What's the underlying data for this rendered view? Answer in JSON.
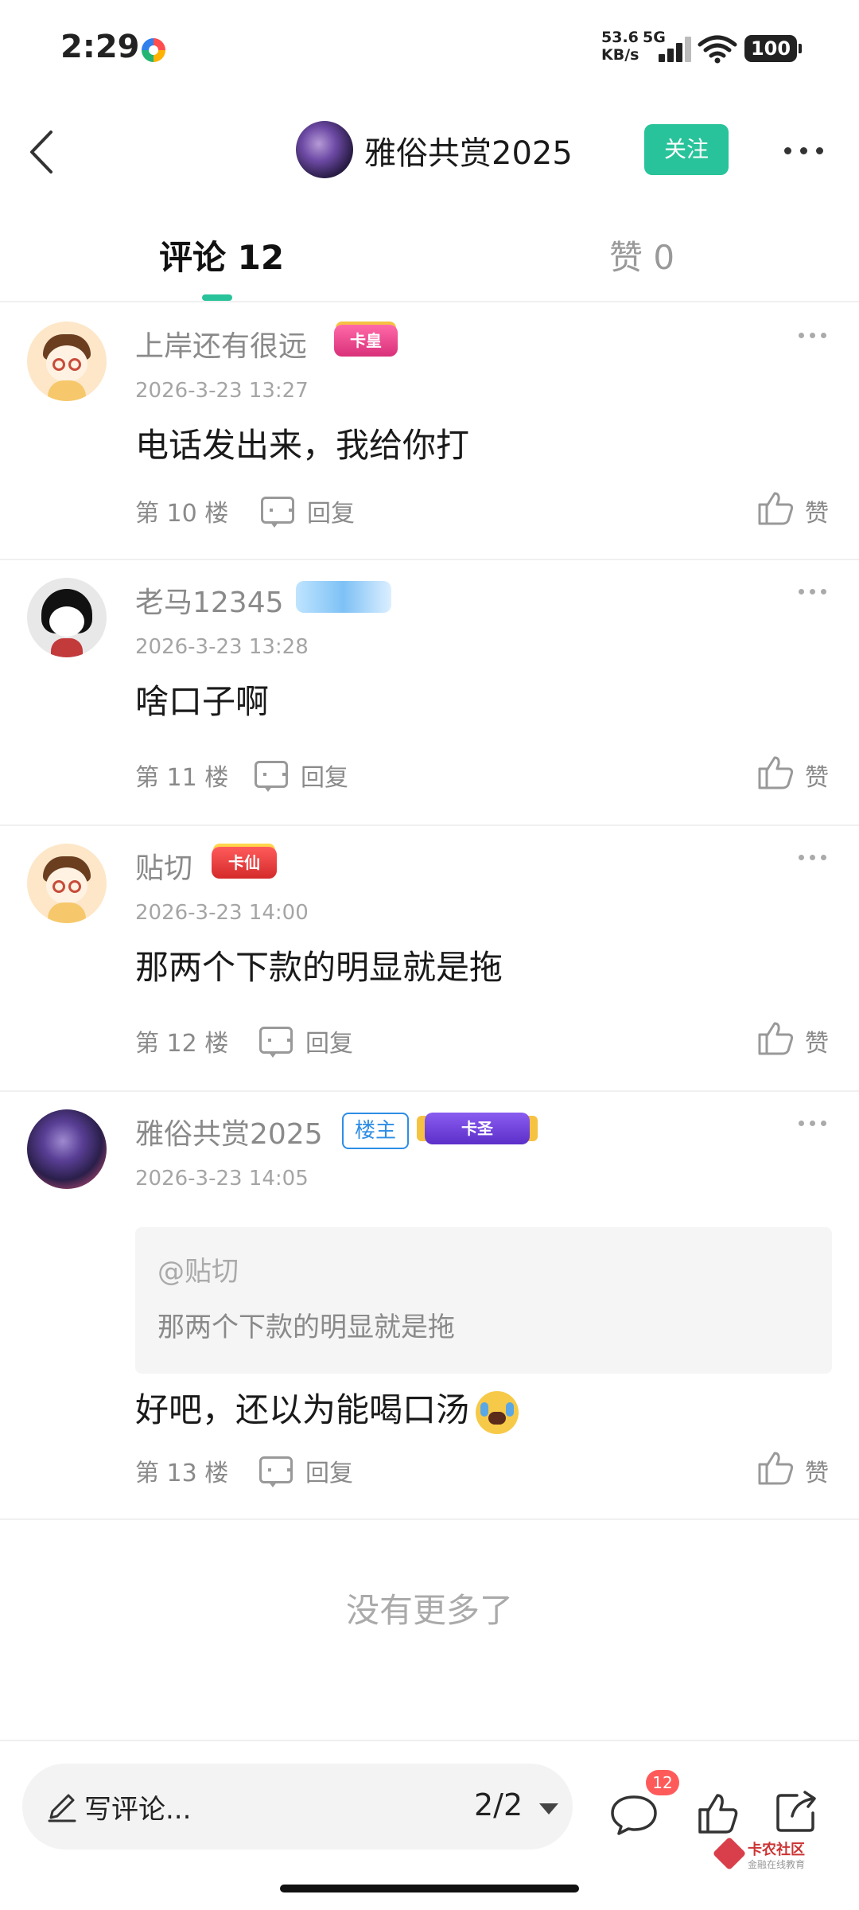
{
  "status_bar": {
    "time": "2:29",
    "net_speed": "53.6",
    "net_unit": "KB/s",
    "network": "5G",
    "battery": "100"
  },
  "header": {
    "title": "雅俗共赏2025",
    "follow_label": "关注"
  },
  "tabs": [
    {
      "label": "评论 12",
      "active": true
    },
    {
      "label": "赞 0",
      "active": false
    }
  ],
  "comments": [
    {
      "user": "上岸还有很远",
      "badge": "卡皇",
      "time": "2026-3-23 13:27",
      "text": "电话发出来，我给你打",
      "floor": "第 10 楼",
      "reply_label": "回复",
      "like_label": "赞"
    },
    {
      "user": "老马12345",
      "badge": "",
      "time": "2026-3-23 13:28",
      "text": "啥口子啊",
      "floor": "第 11 楼",
      "reply_label": "回复",
      "like_label": "赞"
    },
    {
      "user": "贴切",
      "badge": "卡仙",
      "time": "2026-3-23 14:00",
      "text": "那两个下款的明显就是拖",
      "floor": "第 12 楼",
      "reply_label": "回复",
      "like_label": "赞"
    },
    {
      "user": "雅俗共赏2025",
      "owner_badge": "楼主",
      "badge": "卡圣",
      "time": "2026-3-23 14:05",
      "quote_user": "@贴切",
      "quote_text": "那两个下款的明显就是拖",
      "text": "好吧，还以为能喝口汤",
      "floor": "第 13 楼",
      "reply_label": "回复",
      "like_label": "赞"
    }
  ],
  "footer_note": "没有更多了",
  "bottom_bar": {
    "input_placeholder": "写评论...",
    "page_indicator": "2/2",
    "comment_count": "12"
  },
  "watermark": {
    "title": "卡农社区",
    "subtitle": "金融在线教育"
  },
  "colors": {
    "accent": "#28c39a",
    "badge_red": "#ff5a5a",
    "owner_blue": "#2e8de6"
  }
}
